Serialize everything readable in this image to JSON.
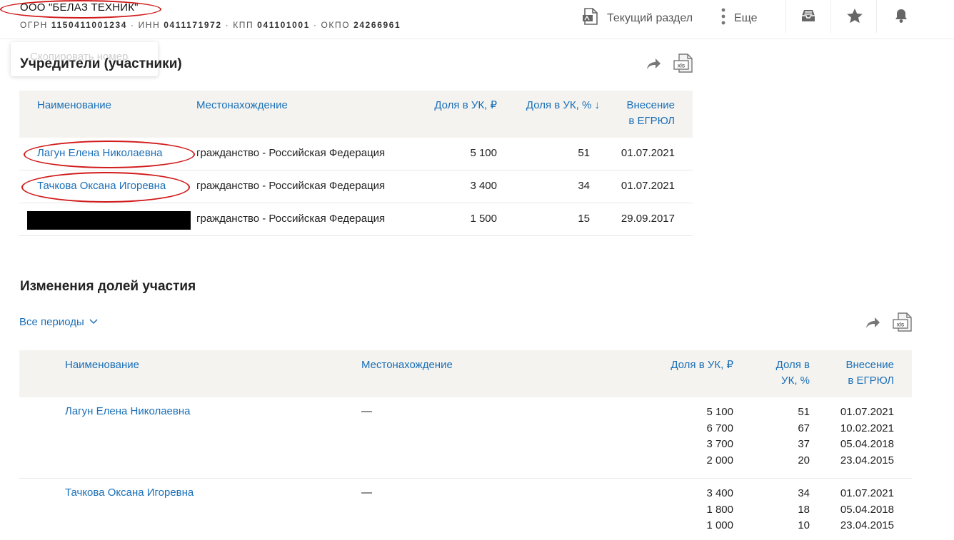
{
  "header": {
    "company_name": "ООО \"БЕЛАЗ ТЕХНИК\"",
    "ids": [
      {
        "label": "ОГРН",
        "value": "1150411001234"
      },
      {
        "label": "ИНН",
        "value": "0411171972"
      },
      {
        "label": "КПП",
        "value": "041101001"
      },
      {
        "label": "ОКПО",
        "value": "24266961"
      }
    ],
    "separator": "·",
    "current_section_label": "Текущий раздел",
    "more_label": "Еще",
    "icons": [
      "pdf-icon",
      "more-dots-icon",
      "inbox-icon",
      "star-icon",
      "bell-icon"
    ]
  },
  "toast": {
    "text": "Скопировать номер"
  },
  "founders": {
    "title": "Учредители (участники)",
    "columns": {
      "name": "Наименование",
      "location": "Местонахождение",
      "share_rub": "Доля в УК, ₽",
      "share_pct": "Доля в УК, % ↓",
      "entry_line1": "Внесение",
      "entry_line2": "в ЕГРЮЛ"
    },
    "rows": [
      {
        "name": "Лагун Елена Николаевна",
        "location": "гражданство - Российская Федерация",
        "share_rub": "5 100",
        "share_pct": "51",
        "date": "01.07.2021"
      },
      {
        "name": "Тачкова Оксана Игоревна",
        "location": "гражданство - Российская Федерация",
        "share_rub": "3 400",
        "share_pct": "34",
        "date": "01.07.2021"
      },
      {
        "name": "",
        "location": "гражданство - Российская Федерация",
        "share_rub": "1 500",
        "share_pct": "15",
        "date": "29.09.2017",
        "name_redacted": true
      }
    ]
  },
  "changes": {
    "title": "Изменения долей участия",
    "period_filter": "Все периоды",
    "columns": {
      "name": "Наименование",
      "location": "Местонахождение",
      "share_rub": "Доля в УК, ₽",
      "share_pct_line1": "Доля в",
      "share_pct_line2": "УК, %",
      "entry_line1": "Внесение",
      "entry_line2": "в ЕГРЮЛ"
    },
    "rows": [
      {
        "name": "Лагун Елена Николаевна",
        "location": "—",
        "share_rub": [
          "5 100",
          "6 700",
          "3 700",
          "2 000"
        ],
        "share_pct": [
          "51",
          "67",
          "37",
          "20"
        ],
        "dates": [
          "01.07.2021",
          "10.02.2021",
          "05.04.2018",
          "23.04.2015"
        ]
      },
      {
        "name": "Тачкова Оксана Игоревна",
        "location": "—",
        "share_rub": [
          "3 400",
          "1 800",
          "1 000"
        ],
        "share_pct": [
          "34",
          "18",
          "10"
        ],
        "dates": [
          "01.07.2021",
          "05.04.2018",
          "23.04.2015"
        ]
      }
    ]
  },
  "colors": {
    "link": "#1a6fb8",
    "table_header_bg": "#f4f3ef",
    "annotation_red": "#d11b1b",
    "redaction": "#000000"
  }
}
